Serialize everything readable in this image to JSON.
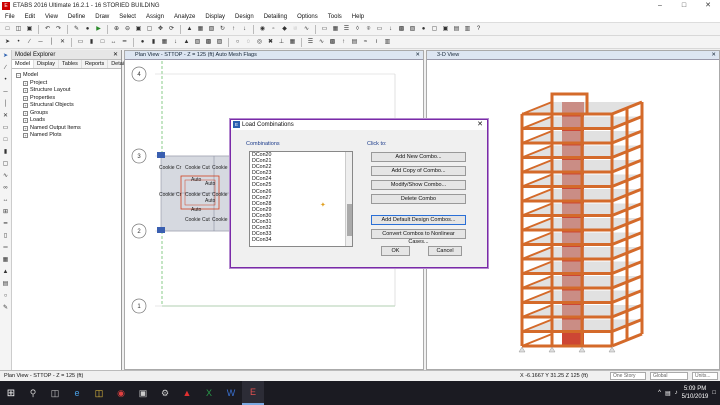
{
  "window": {
    "title": "ETABS 2016 Ultimate 16.2.1 - 16 STORIED BUILDING"
  },
  "menu": [
    "File",
    "Edit",
    "View",
    "Define",
    "Draw",
    "Select",
    "Assign",
    "Analyze",
    "Display",
    "Design",
    "Detailing",
    "Options",
    "Tools",
    "Help"
  ],
  "explorer": {
    "title": "Model Explorer",
    "tabs": [
      "Model",
      "Display",
      "Tables",
      "Reports",
      "Detailing"
    ],
    "root": "Model",
    "children": [
      "Project",
      "Structure Layout",
      "Properties",
      "Structural Objects",
      "Groups",
      "Loads",
      "Named Output Items",
      "Named Plots"
    ]
  },
  "plan_view": {
    "title": "Plan View - STTOP - Z = 125 (ft)  Auto Mesh Flags",
    "grid_labels": [
      "4",
      "3",
      "2",
      "1"
    ],
    "labels": [
      "Cookie Cr",
      "Cookie Cut",
      "Cookie Cut",
      "Cookie Cr",
      "Cookie Cut",
      "Cookie Cut",
      "Cookie Cut",
      "Cookie Cut",
      "Auto",
      "Auto",
      "Auto",
      "Auto"
    ]
  },
  "view_3d": {
    "title": "3-D View"
  },
  "dialog": {
    "title": "Load Combinations",
    "combinations_label": "Combinations",
    "click_to_label": "Click to:",
    "items": [
      "DCon20",
      "DCon21",
      "DCon22",
      "DCon23",
      "DCon24",
      "DCon25",
      "DCon26",
      "DCon27",
      "DCon28",
      "DCon29",
      "DCon30",
      "DCon31",
      "DCon32",
      "DCon33",
      "DCon34"
    ],
    "buttons": {
      "add_new": "Add New Combo...",
      "add_copy": "Add Copy of Combo...",
      "modify": "Modify/Show Combo...",
      "delete": "Delete Combo",
      "add_default": "Add Default Design Combos...",
      "convert": "Convert Combos to Nonlinear Cases...",
      "ok": "OK",
      "cancel": "Cancel"
    }
  },
  "status": {
    "left": "Plan View - STTOP - Z = 125 (ft)",
    "coords": "X -6.1667  Y 31.25  Z 125 (ft)",
    "story": "One Story",
    "coord_sys": "Global",
    "units": "Units..."
  },
  "taskbar": {
    "time": "5:09 PM",
    "date": "5/10/2019"
  },
  "colors": {
    "accent": "#7a2aa8",
    "frame": "#d46a2a",
    "core": "#c8321e"
  }
}
